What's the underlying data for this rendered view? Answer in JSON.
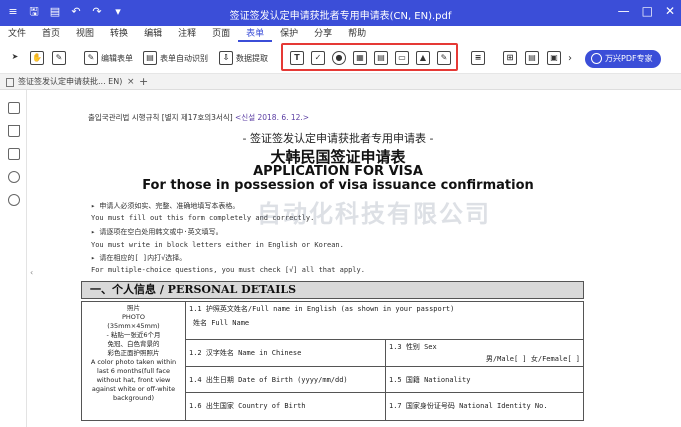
{
  "titlebar": {
    "icons": [
      "≡",
      "🖫",
      "▤",
      "↶",
      "↷",
      "▾"
    ],
    "title": "签证签发认定申请获批者专用申请表(CN, EN).pdf",
    "controls": [
      "—",
      "□",
      "✕"
    ]
  },
  "menu": [
    "文件",
    "首页",
    "视图",
    "转换",
    "编辑",
    "注释",
    "页面",
    "表单",
    "保护",
    "分享",
    "帮助"
  ],
  "menu_active": "表单",
  "toolbar": {
    "edit_form": "编辑表单",
    "auto_recognize": "表单自动识别",
    "extract_data": "数据提取",
    "form_tools": [
      "T",
      "✓",
      "●",
      "▦",
      "▤",
      "▭",
      "▲",
      "✎"
    ],
    "pdf_expert": "万兴PDF专家"
  },
  "tab": {
    "label": "签证签发认定申请获批... EN)",
    "close": "×",
    "add": "+"
  },
  "doc": {
    "header_ko": "출입국관리법 시행규칙 [별지 제17호의3서식]",
    "header_date": "<신설 2018. 6. 12.>",
    "title_cn": "- 签证签发认定申请获批者专用申请表 -",
    "title_cn2": "大韩民国签证申请表",
    "title_en1": "APPLICATION FOR VISA",
    "title_en2": "For those in possession of visa issuance confirmation",
    "watermark": "自动化科技有限公司",
    "instructions": [
      "▸ 申请人必须如实、完整、准确地填写本表格。",
      "  You must fill out this form completely and correctly.",
      "▸ 请逐项在空白处用韩文或中·英文填写。",
      "  You must write in block letters either in English or Korean.",
      "▸ 请在相应的[ ]内打√选择。",
      "  For multiple-choice questions, you must check [√] all that apply."
    ],
    "section": "一、个人信息 / PERSONAL DETAILS",
    "photo_lines": [
      "照片",
      "PHOTO",
      "(35mm×45mm)",
      "- 粘贴一张近6个月",
      "免冠、白色背景的",
      "彩色正面护照照片",
      "A color photo taken within",
      "last 6 months(full face",
      "without hat, front view",
      "against white or off-white",
      "background)"
    ],
    "f11": "1.1 护照英文姓名/Full name in English (as shown in your passport)",
    "f11b": "姓名 Full Name",
    "f12": "1.2 汉字姓名 Name in Chinese",
    "f13": "1.3 性别 Sex",
    "f13b": "男/Male[   ]   女/Female[   ]",
    "f14": "1.4 出生日期 Date of Birth (yyyy/mm/dd)",
    "f15": "1.5 国籍 Nationality",
    "f16": "1.6 出生国家 Country of Birth",
    "f17": "1.7 国家身份证号码 National Identity No."
  }
}
